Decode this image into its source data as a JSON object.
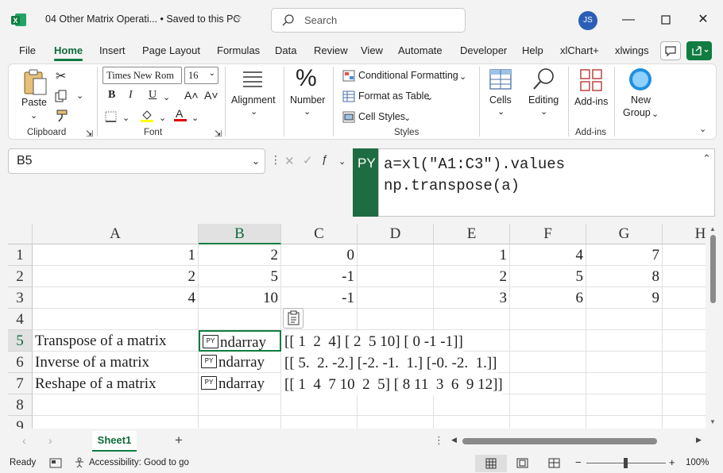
{
  "titlebar": {
    "doc_title": "04 Other Matrix Operati... • Saved to this PC",
    "search_placeholder": "Search",
    "avatar_initials": "JS"
  },
  "tabs": [
    "File",
    "Home",
    "Insert",
    "Page Layout",
    "Formulas",
    "Data",
    "Review",
    "View",
    "Automate",
    "Developer",
    "Help",
    "xlChart+",
    "xlwings"
  ],
  "ribbon": {
    "paste": "Paste",
    "font_name": "Times New Rom",
    "font_size": "16",
    "bold": "B",
    "italic": "I",
    "underline": "U",
    "grow_font": "A˄",
    "shrink_font": "A˅",
    "font_color_glyph": "A",
    "alignment": "Alignment",
    "number": "Number",
    "conditional_formatting": "Conditional Formatting",
    "format_as_table": "Format as Table",
    "cell_styles": "Cell Styles",
    "cells": "Cells",
    "editing": "Editing",
    "addins": "Add-ins",
    "new_group_line1": "New",
    "new_group_line2": "Group",
    "groups": {
      "clipboard": "Clipboard",
      "font": "Font",
      "styles": "Styles",
      "addins": "Add-ins"
    }
  },
  "formula_bar": {
    "name_box": "B5",
    "py_badge": "PY",
    "line1": "a=xl(\"A1:C3\").values",
    "line2": "np.transpose(a)"
  },
  "grid": {
    "columns": [
      "A",
      "B",
      "C",
      "D",
      "E",
      "F",
      "G",
      "H"
    ],
    "rows": [
      "1",
      "2",
      "3",
      "4",
      "5",
      "6",
      "7",
      "8",
      "9"
    ],
    "values": {
      "A1": "1",
      "B1": "2",
      "C1": "0",
      "E1": "1",
      "F1": "4",
      "G1": "7",
      "A2": "2",
      "B2": "5",
      "C2": "-1",
      "E2": "2",
      "F2": "5",
      "G2": "8",
      "A3": "4",
      "B3": "10",
      "C3": "-1",
      "E3": "3",
      "F3": "6",
      "G3": "9",
      "A5": "Transpose of a matrix",
      "A6": "Inverse of a matrix",
      "A7": "Reshape of a matrix"
    },
    "py_icon": "PY",
    "py_cells": [
      "ndarray",
      "ndarray",
      "ndarray"
    ],
    "spill": [
      "[[ 1  2  4] [ 2  5 10] [ 0 -1 -1]]",
      "[[ 5.  2. -2.] [-2. -1.  1.] [-0. -2.  1.]]",
      "[[ 1  4  7 10  2  5] [ 8 11  3  6  9 12]]"
    ]
  },
  "sheet_tab": "Sheet1",
  "status": {
    "ready": "Ready",
    "accessibility": "Accessibility: Good to go",
    "zoom": "100%"
  },
  "colors": {
    "accent": "#107c41",
    "py_green": "#1e6c41",
    "selection": "#107c41"
  }
}
